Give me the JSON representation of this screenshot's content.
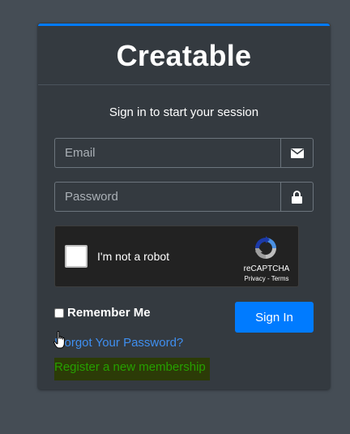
{
  "brand": "Creatable",
  "login_message": "Sign in to start your session",
  "email": {
    "placeholder": "Email",
    "value": "",
    "icon": "envelope-icon"
  },
  "password": {
    "placeholder": "Password",
    "value": "",
    "icon": "lock-icon"
  },
  "recaptcha": {
    "label": "I'm not a robot",
    "brand": "reCAPTCHA",
    "links": "Privacy - Terms",
    "checked": false
  },
  "remember": {
    "label": "Remember Me",
    "checked": false
  },
  "sign_in_label": "Sign In",
  "forgot_label": "I forgot Your Password?",
  "register_label": "Register a new membership",
  "colors": {
    "accent": "#007bff",
    "card_bg": "#343a40",
    "page_bg": "#454d55",
    "link": "#3f8ff0",
    "register_text": "#26a000",
    "register_highlight": "#2c3b07"
  }
}
